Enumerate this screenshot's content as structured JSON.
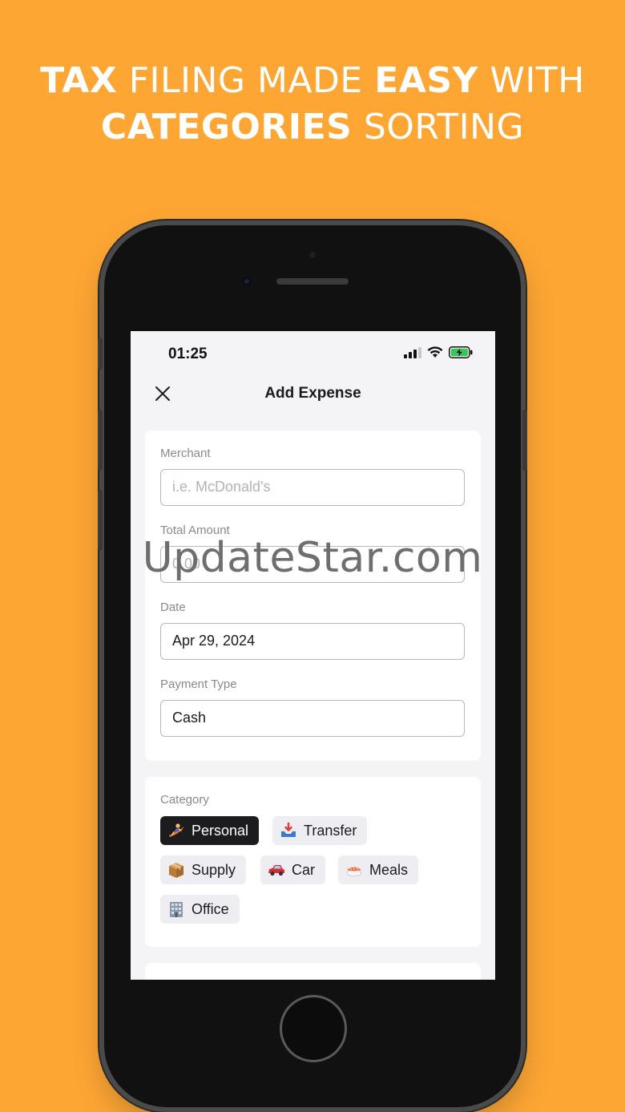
{
  "headline": {
    "line1_bold_a": "TAX",
    "line1_regular_a": "FILING MADE",
    "line1_bold_b": "EASY",
    "line1_regular_b": "WITH",
    "line2_bold": "CATEGORIES",
    "line2_regular": "SORTING"
  },
  "status_bar": {
    "time": "01:25"
  },
  "nav": {
    "title": "Add Expense",
    "close_icon": "close-icon"
  },
  "form": {
    "merchant": {
      "label": "Merchant",
      "value": "",
      "placeholder": "i.e. McDonald's"
    },
    "total_amount": {
      "label": "Total Amount",
      "value": "",
      "placeholder": "0.00"
    },
    "date": {
      "label": "Date",
      "value": "Apr 29, 2024"
    },
    "payment_type": {
      "label": "Payment Type",
      "value": "Cash"
    }
  },
  "category": {
    "label": "Category",
    "selected": "Personal",
    "chips": [
      {
        "label": "Personal",
        "icon": "surfer-icon"
      },
      {
        "label": "Transfer",
        "icon": "inbox-tray-icon"
      },
      {
        "label": "Supply",
        "icon": "package-icon"
      },
      {
        "label": "Car",
        "icon": "car-icon"
      },
      {
        "label": "Meals",
        "icon": "sushi-icon"
      },
      {
        "label": "Office",
        "icon": "office-building-icon"
      }
    ]
  },
  "watermark": "UpdateStar.com",
  "colors": {
    "background": "#FDA634",
    "chip_active": "#1c1c1e",
    "battery": "#34c759"
  }
}
